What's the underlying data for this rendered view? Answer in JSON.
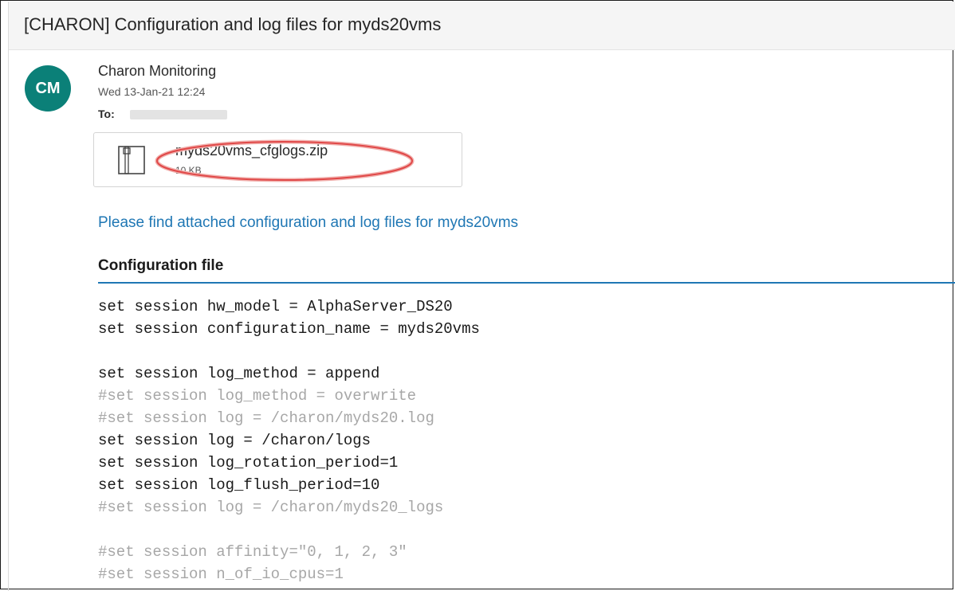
{
  "email": {
    "subject": "[CHARON] Configuration and log files for myds20vms",
    "sender": {
      "initials": "CM",
      "name": "Charon Monitoring",
      "date": "Wed 13-Jan-21 12:24",
      "to_label": "To:",
      "avatar_color": "#0b8078"
    },
    "attachment": {
      "filename": "myds20vms_cfglogs.zip",
      "size": "10 KB",
      "icon": "zip-file-icon",
      "highlight_color": "#e04848"
    },
    "body": {
      "intro": "Please find attached configuration and log files for myds20vms",
      "section_title": "Configuration file",
      "link_color": "#1f77b4",
      "config_lines": [
        {
          "text": "set session hw_model = AlphaServer_DS20",
          "type": "active"
        },
        {
          "text": "set session configuration_name = myds20vms",
          "type": "active"
        },
        {
          "text": "",
          "type": "active"
        },
        {
          "text": "set session log_method = append",
          "type": "active"
        },
        {
          "text": "#set session log_method = overwrite",
          "type": "comment"
        },
        {
          "text": "#set session log = /charon/myds20.log",
          "type": "comment"
        },
        {
          "text": "set session log = /charon/logs",
          "type": "active"
        },
        {
          "text": "set session log_rotation_period=1",
          "type": "active"
        },
        {
          "text": "set session log_flush_period=10",
          "type": "active"
        },
        {
          "text": "#set session log = /charon/myds20_logs",
          "type": "comment"
        },
        {
          "text": "",
          "type": "active"
        },
        {
          "text": "#set session affinity=\"0, 1, 2, 3\"",
          "type": "comment"
        },
        {
          "text": "#set session n_of_io_cpus=1",
          "type": "comment"
        }
      ]
    }
  }
}
